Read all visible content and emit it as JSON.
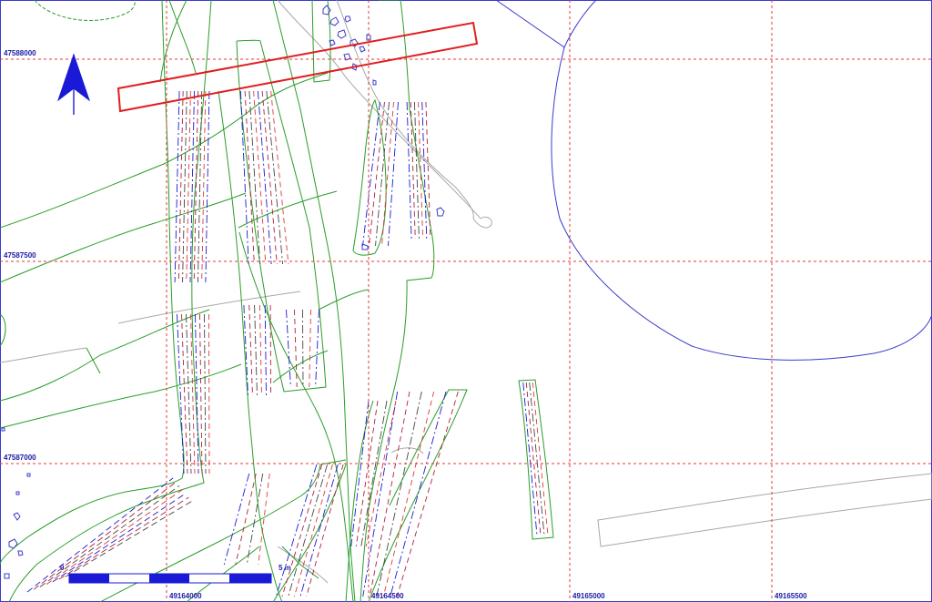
{
  "map": {
    "grid_labels_y": [
      "47588000",
      "47587500",
      "47587000"
    ],
    "grid_labels_x": [
      "49164000",
      "49164500",
      "49165000",
      "49165500"
    ],
    "scale_bar": {
      "start_label": "0",
      "end_label": "5 m"
    },
    "colors": {
      "grid": "#e0393a",
      "forest": "#2a9d2a",
      "water": "#3b3bcc",
      "road": "#a8a8a8",
      "highlight": "#e01e1e",
      "text": "#1a1aa6"
    },
    "icons": [
      "north-arrow-icon"
    ]
  }
}
